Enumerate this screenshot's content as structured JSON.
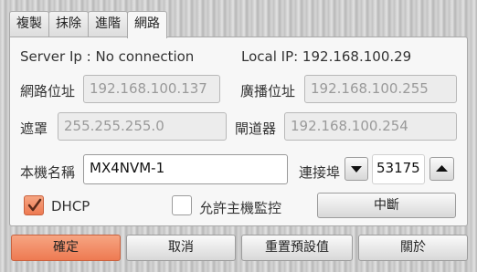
{
  "tabs": [
    "複製",
    "抹除",
    "進階",
    "網路"
  ],
  "active_tab": 3,
  "status": {
    "server_ip": "Server Ip : No connection",
    "local_ip": "Local IP: 192.168.100.29"
  },
  "network": {
    "ip_label": "網路位址",
    "ip_value": "192.168.100.137",
    "broadcast_label": "廣播位址",
    "broadcast_value": "192.168.100.255",
    "mask_label": "遮罩",
    "mask_value": "255.255.255.0",
    "gateway_label": "閘道器",
    "gateway_value": "192.168.100.254",
    "hostname_label": "本機名稱",
    "hostname_value": "MX4NVM-1",
    "port_label": "連接埠",
    "port_value": "53175"
  },
  "options": {
    "dhcp_label": "DHCP",
    "dhcp_checked": true,
    "allow_host_monitor_label": "允許主機監控",
    "allow_host_monitor_checked": false,
    "disconnect_label": "中斷"
  },
  "footer": {
    "ok_label": "確定",
    "cancel_label": "取消",
    "reset_label": "重置預設值",
    "close_label": "關於"
  },
  "colors": {
    "accent": "#ee7a52",
    "panel": "#f7f7f7"
  },
  "icons": {
    "port_decrement": "arrow-down-icon",
    "port_increment": "arrow-up-icon",
    "checkbox_check": "check-icon"
  }
}
